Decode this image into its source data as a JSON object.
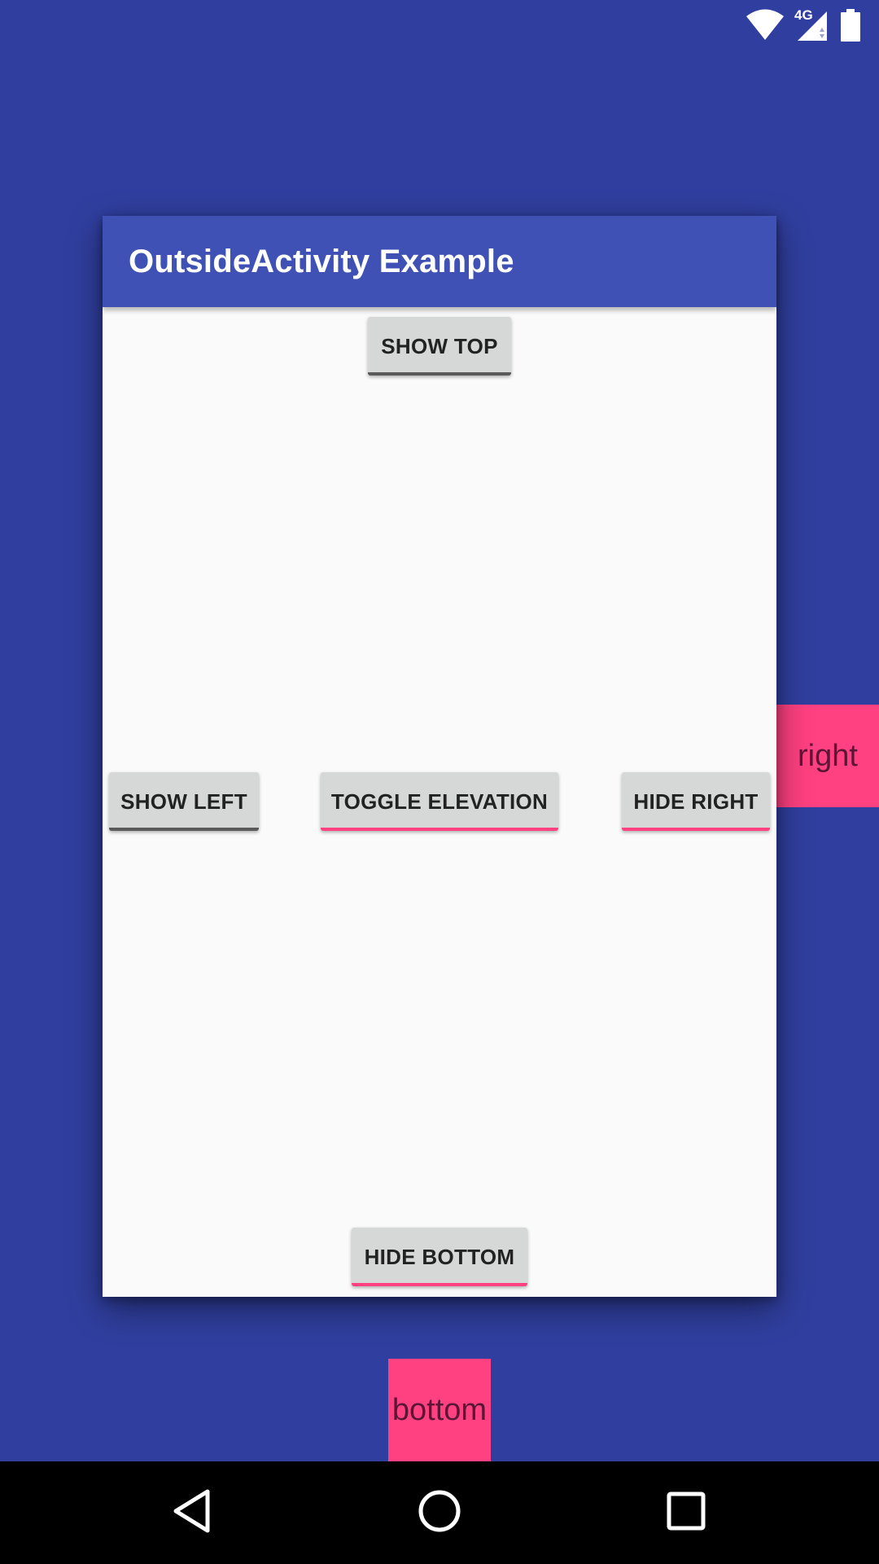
{
  "colors": {
    "window_background": "#303F9F",
    "toolbar": "#3F51B5",
    "accent": "#FF4081",
    "content_background": "#FAFAFA",
    "button": "#D6D7D7",
    "nav_bar": "#000000"
  },
  "status_bar": {
    "network_type": "4G",
    "icons": [
      "wifi-icon",
      "cell-signal-icon",
      "battery-icon"
    ]
  },
  "toolbar": {
    "title": "OutsideActivity Example"
  },
  "buttons": {
    "show_top": "SHOW TOP",
    "show_left": "SHOW LEFT",
    "toggle_elevation": "TOGGLE ELEVATION",
    "hide_right": "HIDE RIGHT",
    "hide_bottom": "HIDE BOTTOM"
  },
  "outside_views": {
    "right": "right",
    "bottom": "bottom"
  },
  "nav_bar": {
    "icons": [
      "back-icon",
      "home-icon",
      "recents-icon"
    ]
  }
}
